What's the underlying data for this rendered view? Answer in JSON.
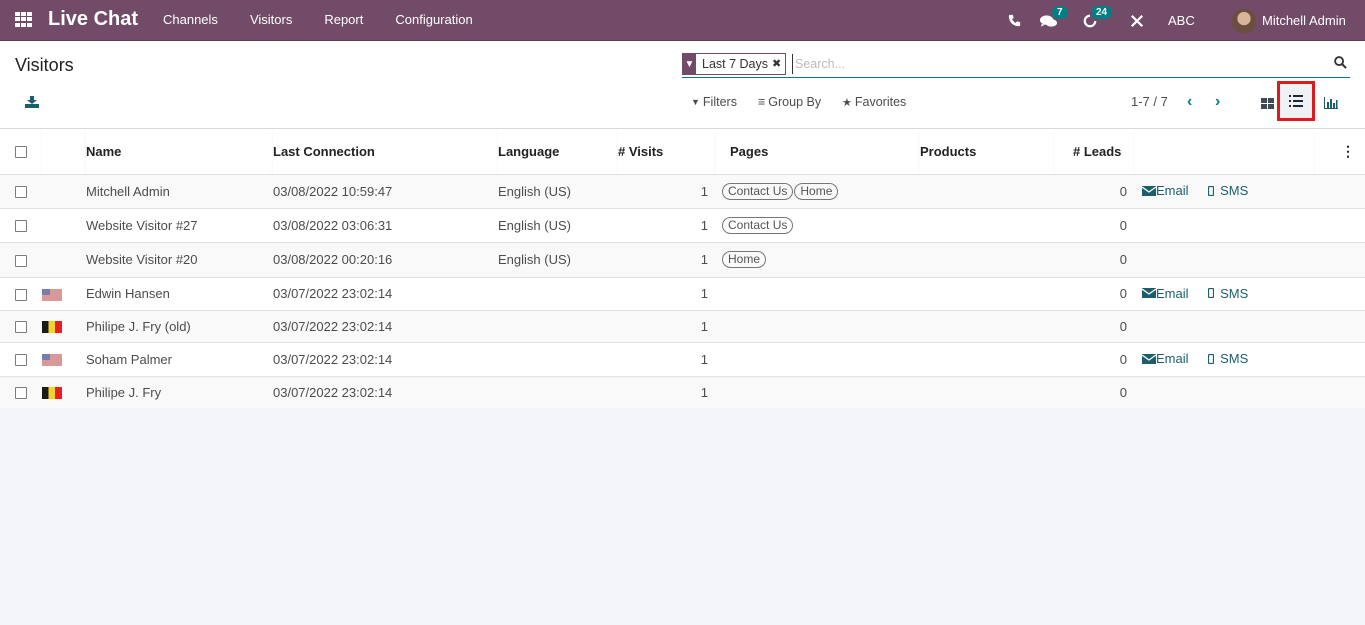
{
  "navbar": {
    "app_name": "Live Chat",
    "menu": [
      "Channels",
      "Visitors",
      "Report",
      "Configuration"
    ],
    "messages_count": "7",
    "activities_count": "24",
    "company": "ABC",
    "user": "Mitchell Admin",
    "colors": {
      "bar": "#714b67",
      "badge": "#017e84"
    }
  },
  "control": {
    "title": "Visitors",
    "facet_label": "Last 7 Days",
    "search_placeholder": "Search...",
    "filters": "Filters",
    "group_by": "Group By",
    "favorites": "Favorites",
    "pager": "1-7 / 7",
    "active_view": "list"
  },
  "table": {
    "columns": [
      "Name",
      "Last Connection",
      "Language",
      "# Visits",
      "Pages",
      "Products",
      "# Leads"
    ],
    "email_label": "Email",
    "sms_label": "SMS",
    "rows": [
      {
        "flag": "",
        "name": "Mitchell Admin",
        "last_connection": "03/08/2022 10:59:47",
        "language": "English (US)",
        "visits": "1",
        "pages": [
          "Contact Us",
          "Home"
        ],
        "products": "",
        "leads": "0",
        "actions": true
      },
      {
        "flag": "",
        "name": "Website Visitor #27",
        "last_connection": "03/08/2022 03:06:31",
        "language": "English (US)",
        "visits": "1",
        "pages": [
          "Contact Us"
        ],
        "products": "",
        "leads": "0",
        "actions": false
      },
      {
        "flag": "",
        "name": "Website Visitor #20",
        "last_connection": "03/08/2022 00:20:16",
        "language": "English (US)",
        "visits": "1",
        "pages": [
          "Home"
        ],
        "products": "",
        "leads": "0",
        "actions": false
      },
      {
        "flag": "us",
        "name": "Edwin Hansen",
        "last_connection": "03/07/2022 23:02:14",
        "language": "",
        "visits": "1",
        "pages": [],
        "products": "",
        "leads": "0",
        "actions": true
      },
      {
        "flag": "be",
        "name": "Philipe J. Fry (old)",
        "last_connection": "03/07/2022 23:02:14",
        "language": "",
        "visits": "1",
        "pages": [],
        "products": "",
        "leads": "0",
        "actions": false
      },
      {
        "flag": "us",
        "name": "Soham Palmer",
        "last_connection": "03/07/2022 23:02:14",
        "language": "",
        "visits": "1",
        "pages": [],
        "products": "",
        "leads": "0",
        "actions": true
      },
      {
        "flag": "be",
        "name": "Philipe J. Fry",
        "last_connection": "03/07/2022 23:02:14",
        "language": "",
        "visits": "1",
        "pages": [],
        "products": "",
        "leads": "0",
        "actions": false
      }
    ]
  }
}
